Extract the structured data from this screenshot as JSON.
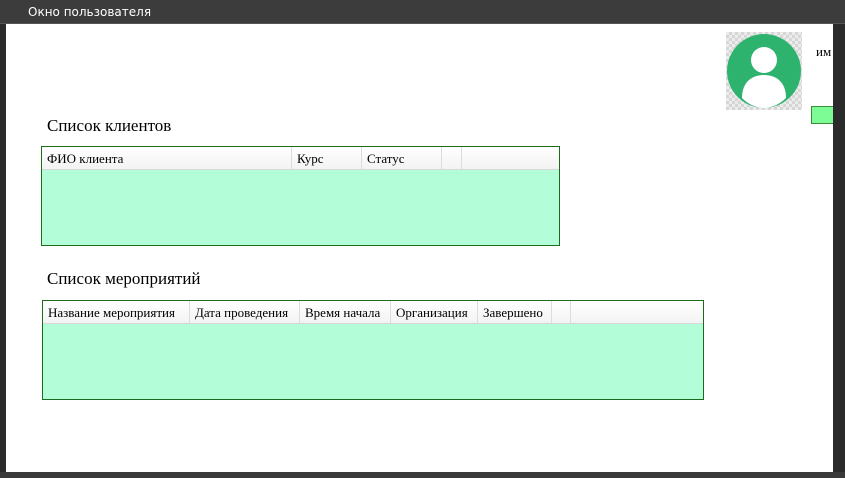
{
  "window": {
    "title": "Окно пользователя"
  },
  "user": {
    "name_label": "им",
    "action_label": ""
  },
  "clients": {
    "title": "Список клиентов",
    "columns": [
      "ФИО клиента",
      "Курс",
      "Статус"
    ],
    "rows": []
  },
  "events": {
    "title": "Список мероприятий",
    "columns": [
      "Название мероприятия",
      "Дата проведения",
      "Время начала",
      "Организация",
      "Завершено"
    ],
    "rows": []
  },
  "colors": {
    "grid_background": "#b3fdd9",
    "grid_border": "#1e6b1e",
    "avatar_accent": "#2eb36f",
    "button_fill": "#7dfc96"
  },
  "icons": {
    "avatar": "user-avatar-icon"
  }
}
